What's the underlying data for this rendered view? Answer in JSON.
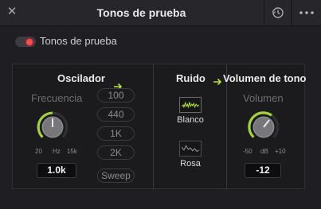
{
  "window": {
    "title": "Tonos de prueba"
  },
  "header": {
    "close_icon": "close-icon",
    "history_icon": "history-icon",
    "more_icon": "more-icon"
  },
  "enable": {
    "label": "Tonos de prueba",
    "on": true,
    "indicator_color": "#ff4a4a"
  },
  "oscillator": {
    "title": "Oscilador",
    "frequency_label": "Frecuencia",
    "scale": {
      "min": "20",
      "unit": "Hz",
      "max": "15k"
    },
    "value": "1.0k",
    "presets": [
      "100",
      "440",
      "1K",
      "2K"
    ],
    "sweep_label": "Sweep"
  },
  "noise": {
    "title": "Ruido",
    "white_label": "Blanco",
    "pink_label": "Rosa"
  },
  "volume": {
    "title": "Volumen de tono",
    "label": "Volumen",
    "scale": {
      "min": "-50",
      "unit": "dB",
      "max": "+10"
    },
    "value": "-12"
  },
  "colors": {
    "accent": "#b9e23a",
    "knob_arc": "#a6d13a"
  }
}
